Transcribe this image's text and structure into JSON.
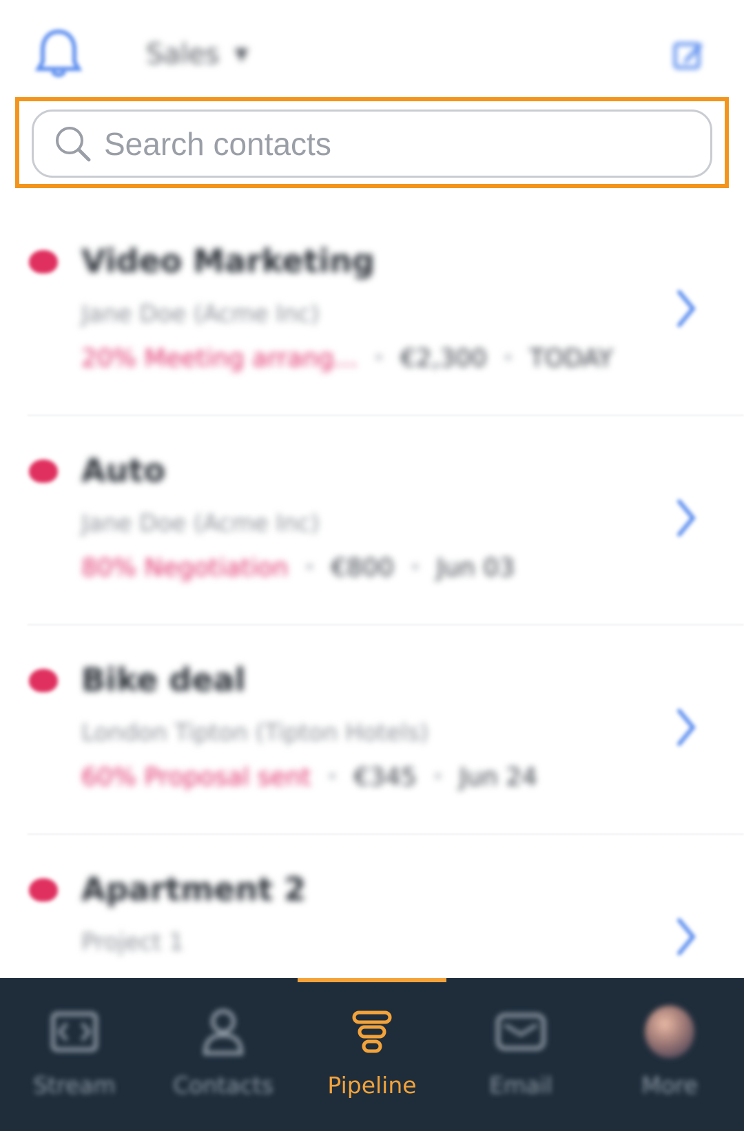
{
  "header": {
    "pipeline_name": "Sales",
    "caret": "▼"
  },
  "search": {
    "placeholder": "Search contacts",
    "value": ""
  },
  "deals": [
    {
      "title": "Video Marketing",
      "contact": "Jane Doe (Acme Inc)",
      "stage": "20% Meeting arrang...",
      "value": "€2,300",
      "date": "TODAY"
    },
    {
      "title": "Auto",
      "contact": "Jane Doe (Acme Inc)",
      "stage": "80% Negotiation",
      "value": "€800",
      "date": "Jun 03"
    },
    {
      "title": "Bike deal",
      "contact": "London Tipton (Tipton Hotels)",
      "stage": "60% Proposal sent",
      "value": "€345",
      "date": "Jun 24"
    },
    {
      "title": "Apartment 2",
      "contact": "Project 1",
      "stage": "",
      "value": "",
      "date": ""
    }
  ],
  "nav": [
    {
      "label": "Stream",
      "icon": "stream-icon",
      "active": false
    },
    {
      "label": "Contacts",
      "icon": "contacts-icon",
      "active": false
    },
    {
      "label": "Pipeline",
      "icon": "pipeline-icon",
      "active": true
    },
    {
      "label": "Email",
      "icon": "email-icon",
      "active": false
    },
    {
      "label": "More",
      "icon": "avatar",
      "active": false
    }
  ],
  "colors": {
    "accent": "#f3951c",
    "nav_active": "#f3a33a",
    "nav_background": "#1f2d3b",
    "deal_dot": "#e0305f",
    "stage_text": "#e0306a",
    "link_blue": "#5b8def"
  }
}
